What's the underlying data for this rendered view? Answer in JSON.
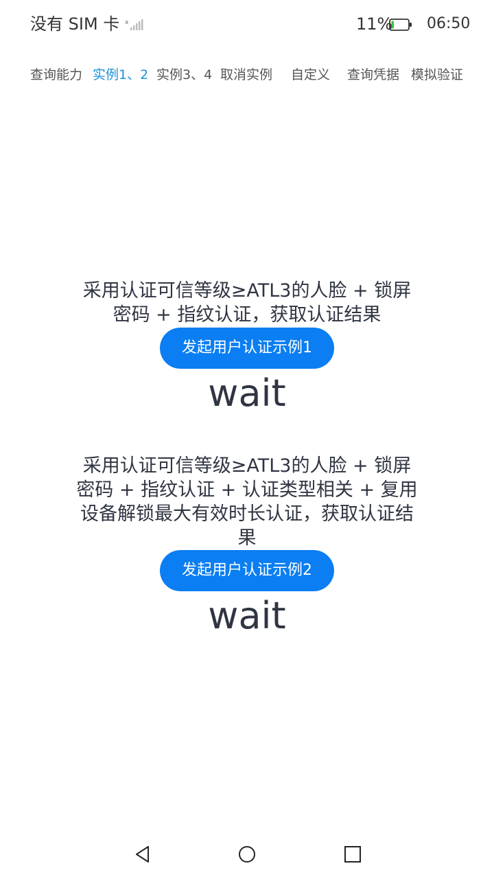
{
  "status_bar": {
    "carrier": "没有 SIM 卡",
    "battery_percent": "11%",
    "time": "06:50",
    "battery_level": 0.11,
    "icons": [
      "signal-icon",
      "battery-icon"
    ]
  },
  "tabs": [
    {
      "label": "查询能力",
      "active": false
    },
    {
      "label": "实例1、2",
      "active": true
    },
    {
      "label": "实例3、4",
      "active": false
    },
    {
      "label": "取消实例",
      "active": false
    },
    {
      "label": "自定义",
      "active": false
    },
    {
      "label": "查询凭据",
      "active": false
    },
    {
      "label": "模拟验证",
      "active": false
    }
  ],
  "example1": {
    "description": "采用认证可信等级≥ATL3的人脸 + 锁屏密码 + 指纹认证，获取认证结果",
    "button_label": "发起用户认证示例1",
    "result": "wait"
  },
  "example2": {
    "description": "采用认证可信等级≥ATL3的人脸 + 锁屏密码 + 指纹认证 + 认证类型相关 + 复用设备解锁最大有效时长认证，获取认证结果",
    "button_label": "发起用户认证示例2",
    "result": "wait"
  },
  "navbar": {
    "icons": [
      "back-icon",
      "home-icon",
      "recents-icon"
    ]
  },
  "colors": {
    "accent": "#0a7ef2",
    "active_tab": "#1a90d8",
    "text": "#2f3542"
  }
}
